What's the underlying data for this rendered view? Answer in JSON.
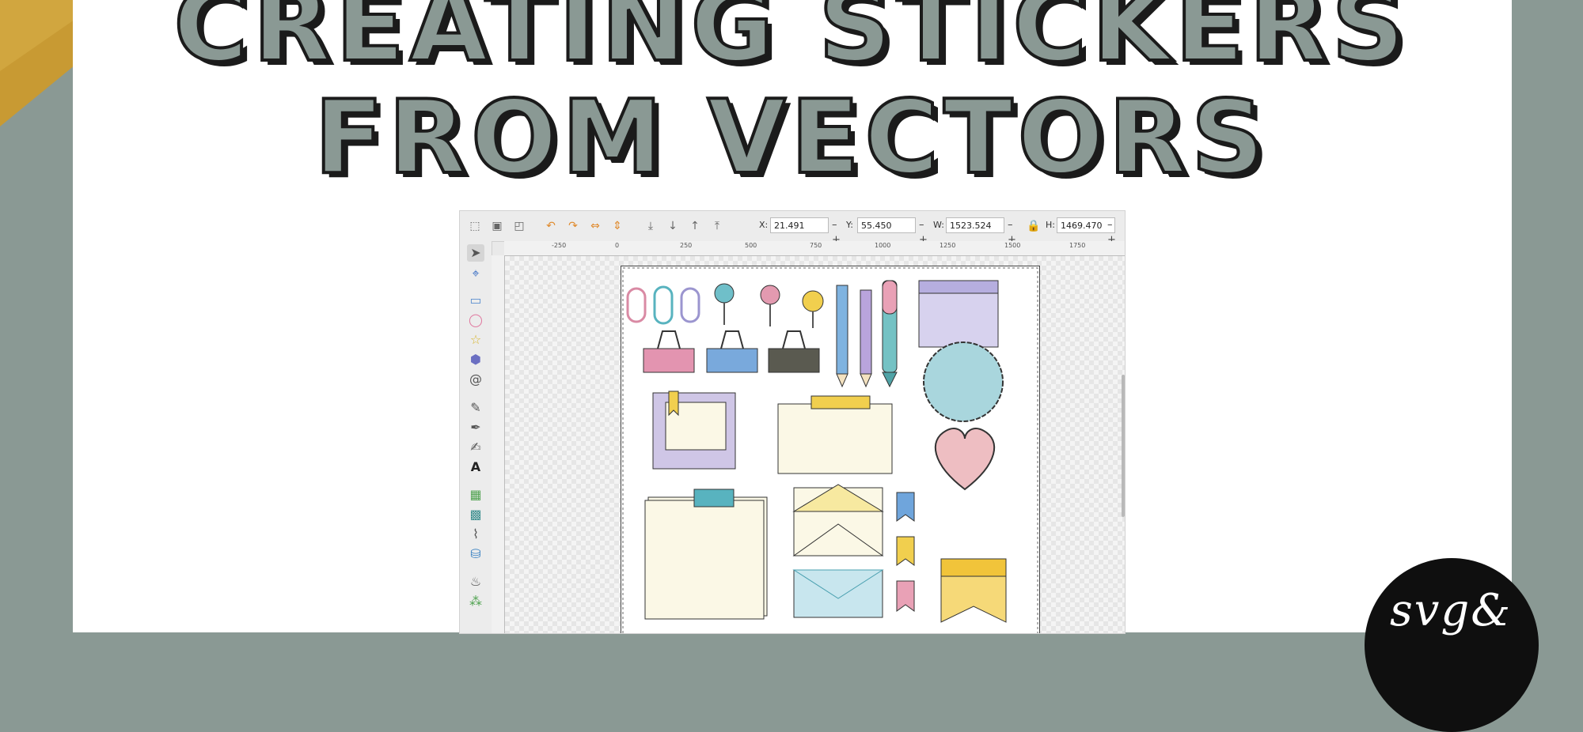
{
  "title": {
    "line1": "CREATING STICKERS",
    "line2": "FROM VECTORS"
  },
  "colors": {
    "background": "#8a9994",
    "card": "#ffffff",
    "title_fill": "#8a9994",
    "title_outline": "#1b1b1b",
    "gold_accent": "#c89a33",
    "badge": "#0f0f0f"
  },
  "editor": {
    "toolbar": {
      "icons": [
        "select-all-icon",
        "select-in-all-layers-icon",
        "deselect-icon",
        "rotate-ccw-icon",
        "rotate-cw-icon",
        "flip-horizontal-icon",
        "flip-vertical-icon",
        "lower-to-bottom-icon",
        "lower-icon",
        "raise-icon",
        "raise-to-top-icon"
      ],
      "fields": [
        {
          "label": "X:",
          "value": "21.491"
        },
        {
          "label": "Y:",
          "value": "55.450"
        },
        {
          "label": "W:",
          "value": "1523.524"
        },
        {
          "label": "H:",
          "value": "1469.470"
        }
      ],
      "stepper_label": "– +"
    },
    "ruler": {
      "numbers": [
        "-250",
        "0",
        "250",
        "500",
        "750",
        "1000",
        "1250",
        "1500",
        "1750"
      ]
    },
    "tools": [
      "selector-tool-icon",
      "node-tool-icon",
      "rectangle-tool-icon",
      "ellipse-tool-icon",
      "star-tool-icon",
      "3d-box-tool-icon",
      "spiral-tool-icon",
      "pencil-tool-icon",
      "pen-tool-icon",
      "calligraphy-tool-icon",
      "text-tool-icon",
      "gradient-tool-icon",
      "mesh-tool-icon",
      "dropper-tool-icon",
      "paint-bucket-tool-icon",
      "tweak-tool-icon",
      "spray-tool-icon"
    ],
    "text_tool_glyph": "A"
  },
  "logo": {
    "text": "svg&"
  }
}
